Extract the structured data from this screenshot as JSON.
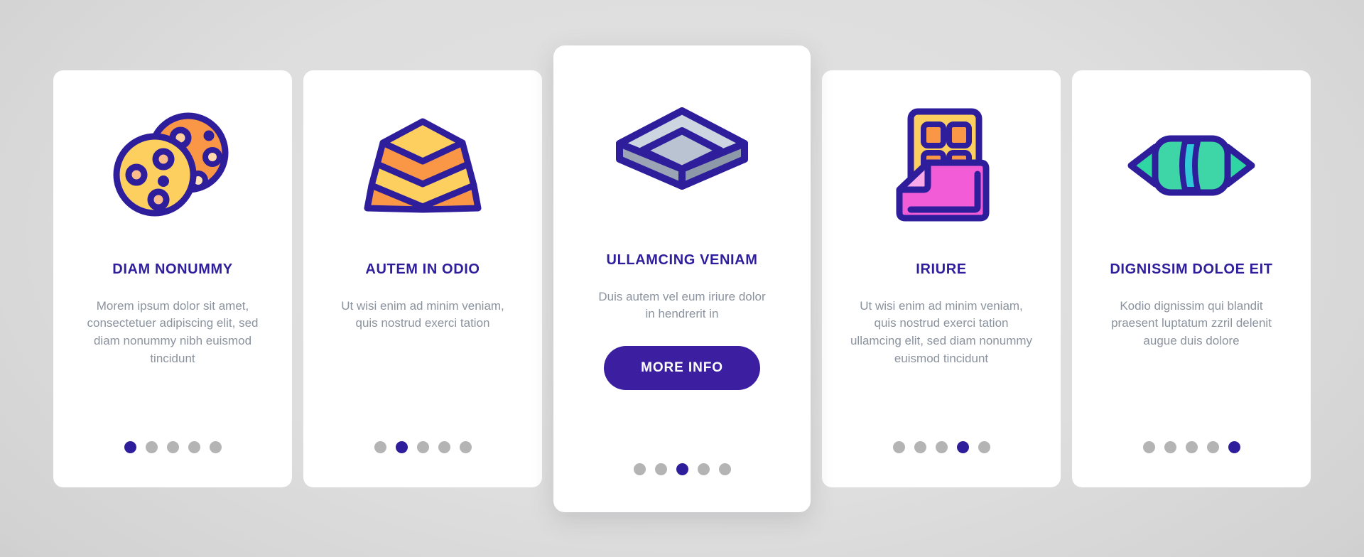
{
  "theme": {
    "primary": "#2e1e9c",
    "button_bg": "#3b1fa0",
    "body_text": "#8b939e",
    "card_bg": "#ffffff",
    "dot_inactive": "#b4b4b4",
    "background": "#dedede"
  },
  "cards": [
    {
      "icon": "cookies-icon",
      "title": "DIAM NONUMMY",
      "description": "Morem ipsum dolor sit amet, consectetuer adipiscing elit, sed diam nonummy nibh euismod tincidunt",
      "featured": false,
      "dots": {
        "count": 5,
        "active_index": 0
      }
    },
    {
      "icon": "layer-cake-icon",
      "title": "AUTEM IN ODIO",
      "description": "Ut wisi enim ad minim veniam, quis nostrud exerci tation",
      "featured": false,
      "dots": {
        "count": 5,
        "active_index": 1
      }
    },
    {
      "icon": "chocolate-slab-icon",
      "title": "ULLAMCING VENIAM",
      "description": "Duis autem vel eum iriure dolor in hendrerit in",
      "button_label": "MORE INFO",
      "featured": true,
      "dots": {
        "count": 5,
        "active_index": 2
      }
    },
    {
      "icon": "chocolate-bar-icon",
      "title": "IRIURE",
      "description": "Ut wisi enim ad minim veniam, quis nostrud exerci tation ullamcing elit, sed diam nonummy euismod tincidunt",
      "featured": false,
      "dots": {
        "count": 5,
        "active_index": 3
      }
    },
    {
      "icon": "wrapped-candy-icon",
      "title": "DIGNISSIM DOLOE EIT",
      "description": "Kodio dignissim qui blandit praesent luptatum zzril delenit augue duis dolore",
      "featured": false,
      "dots": {
        "count": 5,
        "active_index": 4
      }
    }
  ]
}
